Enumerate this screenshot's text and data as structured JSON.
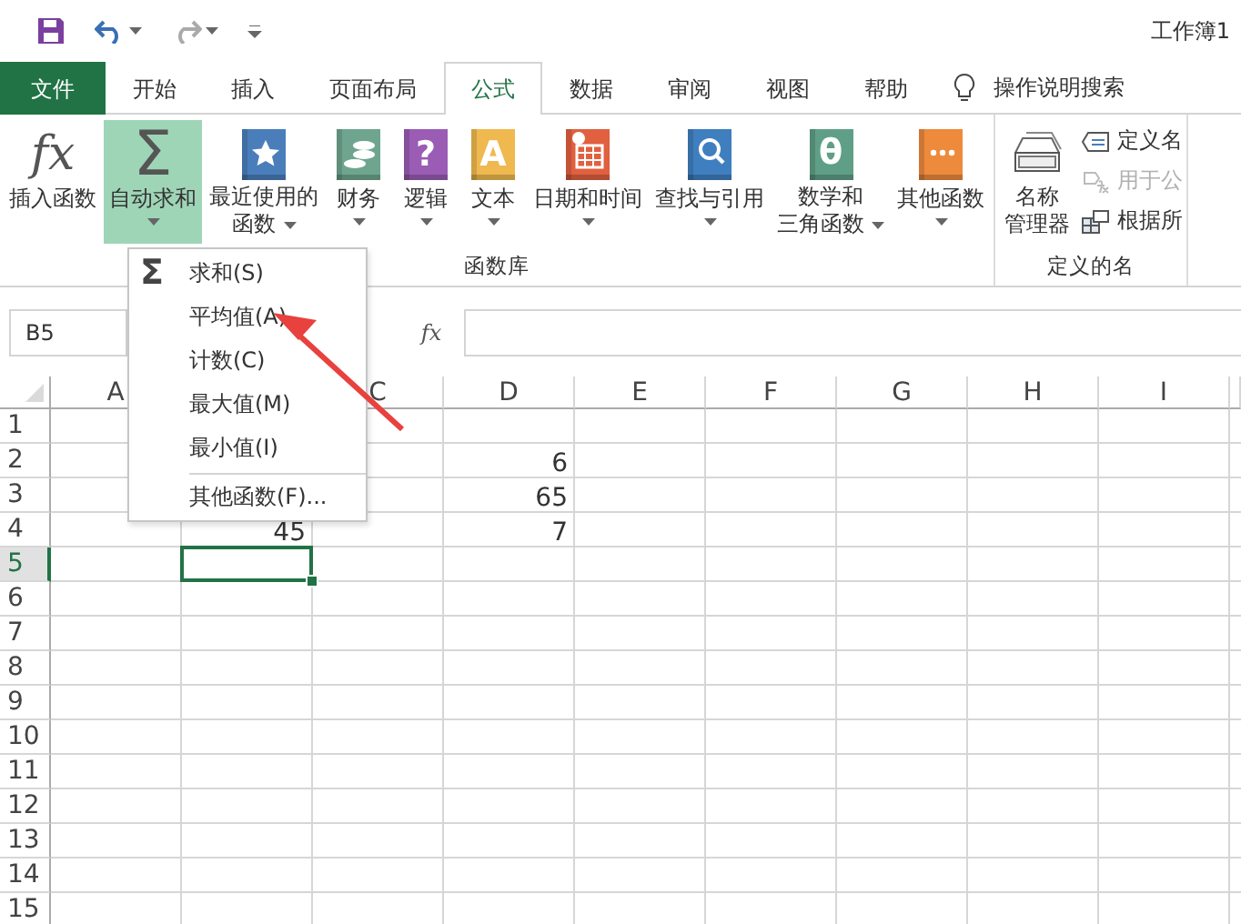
{
  "title_bar": {
    "title": "工作簿1"
  },
  "tabs": [
    {
      "label": "文件",
      "kind": "file",
      "selected": false
    },
    {
      "label": "开始",
      "kind": "tab",
      "selected": false
    },
    {
      "label": "插入",
      "kind": "tab",
      "selected": false
    },
    {
      "label": "页面布局",
      "kind": "tab",
      "selected": false
    },
    {
      "label": "公式",
      "kind": "tab",
      "selected": true
    },
    {
      "label": "数据",
      "kind": "tab",
      "selected": false
    },
    {
      "label": "审阅",
      "kind": "tab",
      "selected": false
    },
    {
      "label": "视图",
      "kind": "tab",
      "selected": false
    },
    {
      "label": "帮助",
      "kind": "tab",
      "selected": false
    }
  ],
  "tell_me": {
    "label": "操作说明搜索"
  },
  "ribbon": {
    "groups": [
      {
        "label": "函数库",
        "buttons": [
          {
            "lines": [
              "插入函数"
            ],
            "kind": "glyph",
            "glyph": "fx",
            "dropdown": false,
            "selected": false
          },
          {
            "lines": [
              "自动求和"
            ],
            "kind": "glyph",
            "glyph": "Σ",
            "dropdown": true,
            "selected": true
          },
          {
            "lines": [
              "最近使用的",
              "函数"
            ],
            "kind": "star",
            "color": "#4a7ebb",
            "dropdown": true,
            "selected": false
          },
          {
            "lines": [
              "财务"
            ],
            "kind": "coins",
            "color": "#6fa58f",
            "dropdown": true,
            "selected": false
          },
          {
            "lines": [
              "逻辑"
            ],
            "kind": "book",
            "glyph": "?",
            "color": "#9a5cb4",
            "dropdown": true,
            "selected": false
          },
          {
            "lines": [
              "文本"
            ],
            "kind": "book",
            "glyph": "A",
            "color": "#efb94f",
            "dropdown": true,
            "selected": false
          },
          {
            "lines": [
              "日期和时间"
            ],
            "kind": "calendar",
            "color": "#e0603f",
            "dropdown": true,
            "selected": false
          },
          {
            "lines": [
              "查找与引用"
            ],
            "kind": "search",
            "color": "#3f7fbf",
            "dropdown": true,
            "selected": false
          },
          {
            "lines": [
              "数学和",
              "三角函数"
            ],
            "kind": "book",
            "glyph": "θ",
            "color": "#5f9f88",
            "dropdown": true,
            "selected": false
          },
          {
            "lines": [
              "其他函数"
            ],
            "kind": "dots",
            "color": "#ee8a3c",
            "dropdown": true,
            "selected": false
          }
        ]
      },
      {
        "label": "定义的名",
        "buttons": [
          {
            "lines": [
              "名称",
              "管理器"
            ],
            "kind": "names",
            "dropdown": false,
            "selected": false
          }
        ],
        "small_buttons": [
          {
            "label": "定义名",
            "kind": "tag",
            "disabled": false
          },
          {
            "label": "用于公",
            "kind": "fx",
            "disabled": true
          },
          {
            "label": "根据所",
            "kind": "table",
            "disabled": false
          }
        ]
      }
    ]
  },
  "formula_bar": {
    "name_box": "B5",
    "fx": "fx"
  },
  "sheet": {
    "columns": [
      {
        "kind": "header",
        "label": "A"
      },
      {
        "kind": "covered"
      },
      {
        "kind": "header",
        "label": "C"
      },
      {
        "kind": "header",
        "label": "D"
      },
      {
        "kind": "header",
        "label": "E"
      },
      {
        "kind": "header",
        "label": "F"
      },
      {
        "kind": "header",
        "label": "G"
      },
      {
        "kind": "header",
        "label": "H"
      },
      {
        "kind": "header",
        "label": "I"
      }
    ],
    "rows": [
      {
        "number": "1",
        "selected": false
      },
      {
        "number": "2",
        "selected": false,
        "cells": {
          "D": {
            "value": "6"
          }
        }
      },
      {
        "number": "3",
        "selected": false,
        "cells": {
          "D": {
            "value": "65"
          }
        }
      },
      {
        "number": "4",
        "selected": false,
        "cells": {
          "B": {
            "value": "45"
          },
          "D": {
            "value": "7"
          }
        }
      },
      {
        "number": "5",
        "selected": true,
        "cells": {
          "B": {
            "selected": true
          }
        }
      },
      {
        "number": "6",
        "selected": false
      },
      {
        "number": "7",
        "selected": false
      },
      {
        "number": "8",
        "selected": false
      },
      {
        "number": "9",
        "selected": false
      },
      {
        "number": "10",
        "selected": false
      },
      {
        "number": "11",
        "selected": false
      },
      {
        "number": "12",
        "selected": false
      },
      {
        "number": "13",
        "selected": false
      },
      {
        "number": "14",
        "selected": false
      },
      {
        "number": "15",
        "selected": false
      }
    ]
  },
  "dropdown_menu": {
    "items": [
      {
        "label": "求和(S)",
        "glyph": "Σ",
        "separator_before": false
      },
      {
        "label": "平均值(A)",
        "separator_before": false
      },
      {
        "label": "计数(C)",
        "separator_before": false
      },
      {
        "label": "最大值(M)",
        "separator_before": false
      },
      {
        "label": "最小值(I)",
        "separator_before": false
      },
      {
        "label": "其他函数(F)...",
        "separator_before": true
      }
    ]
  }
}
